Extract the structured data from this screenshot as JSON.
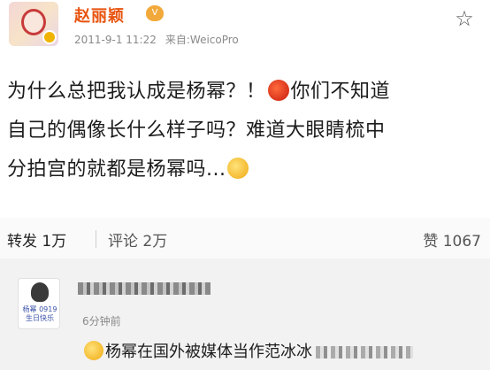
{
  "post": {
    "username": "赵丽颖",
    "timestamp": "2011-9-1 11:22",
    "source": "来自:WeicoPro",
    "content_line1_a": "为什么总把我认成是杨幂？！",
    "content_line1_b": "你们不知道",
    "content_line2": "自己的偶像长什么样子吗？难道大眼睛梳中",
    "content_line3": "分拍宫的就都是杨幂吗...",
    "icons": {
      "avatar": "avatar-image",
      "vip": "vip-badge-icon",
      "favorite": "star-icon",
      "emoji_angry": "angry-emoji-icon",
      "emoji_cry": "crying-emoji-icon"
    }
  },
  "actions": {
    "repost_label": "转发",
    "repost_count": "1万",
    "comment_label": "评论",
    "comment_count": "2万",
    "like_label": "赞",
    "like_count": "1067"
  },
  "comment": {
    "time": "6分钟前",
    "text": "杨幂在国外被媒体当作范冰冰",
    "avatar_caption": "杨幂 0919 生日快乐"
  },
  "colors": {
    "username": "#e8530e",
    "meta": "#8a8a8a",
    "comment_bg": "#f2f2f2"
  }
}
